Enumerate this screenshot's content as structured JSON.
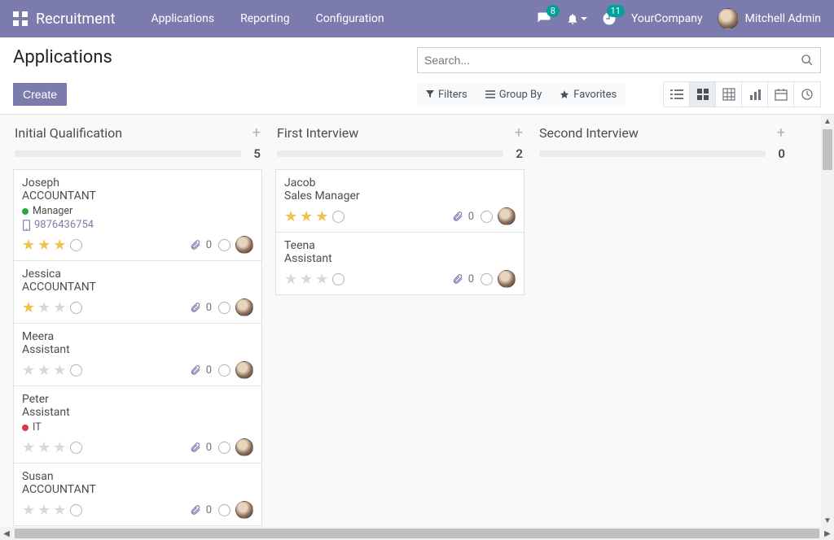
{
  "nav": {
    "brand": "Recruitment",
    "links": [
      "Applications",
      "Reporting",
      "Configuration"
    ],
    "messages_badge": "8",
    "activities_badge": "11",
    "company": "YourCompany",
    "user": "Mitchell Admin"
  },
  "cp": {
    "title": "Applications",
    "create": "Create",
    "search_placeholder": "Search...",
    "filters": "Filters",
    "groupby": "Group By",
    "favorites": "Favorites"
  },
  "columns": [
    {
      "title": "Initial Qualification",
      "count": "5",
      "cards": [
        {
          "name": "Joseph",
          "role": "ACCOUNTANT",
          "tag": "Manager",
          "tagColor": "green",
          "phone": "9876436754",
          "stars": 3,
          "attachments": "0"
        },
        {
          "name": "Jessica",
          "role": "ACCOUNTANT",
          "stars": 1,
          "attachments": "0"
        },
        {
          "name": "Meera",
          "role": "Assistant",
          "stars": 0,
          "attachments": "0"
        },
        {
          "name": "Peter",
          "role": "Assistant",
          "tag": "IT",
          "tagColor": "red",
          "stars": 0,
          "attachments": "0"
        },
        {
          "name": "Susan",
          "role": "ACCOUNTANT",
          "stars": 0,
          "attachments": "0"
        }
      ]
    },
    {
      "title": "First Interview",
      "count": "2",
      "cards": [
        {
          "name": "Jacob",
          "role": "Sales Manager",
          "stars": 3,
          "attachments": "0"
        },
        {
          "name": "Teena",
          "role": "Assistant",
          "stars": 0,
          "attachments": "0"
        }
      ]
    },
    {
      "title": "Second Interview",
      "count": "0",
      "cards": []
    }
  ]
}
